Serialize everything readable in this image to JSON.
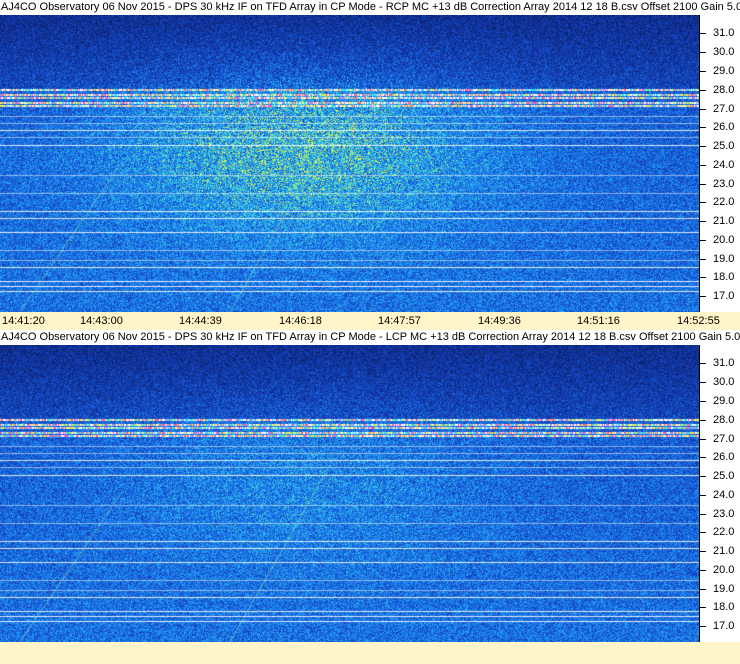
{
  "panels": [
    {
      "title": "AJ4CO Observatory 06 Nov 2015 - DPS 30 kHz IF on TFD Array in CP Mode - RCP  MC +13 dB  Correction Array 2014 12 18 B.csv  Offset 2100  Gain 5.0",
      "freq_labels": [
        "31.0",
        "30.0",
        "29.0",
        "28.0",
        "27.0",
        "26.0",
        "25.0",
        "24.0",
        "23.0",
        "22.0",
        "21.0",
        "20.0",
        "19.0",
        "18.0",
        "17.0"
      ],
      "time_labels": [
        "14:41:20",
        "14:43:00",
        "14:44:39",
        "14:46:18",
        "14:47:57",
        "14:49:36",
        "14:51:16",
        "14:52:55"
      ]
    },
    {
      "title": "AJ4CO Observatory 06 Nov 2015 - DPS 30 kHz IF on TFD Array in CP Mode - LCP  MC +13 dB  Correction Array 2014 12 18 B.csv  Offset 2100  Gain 5.0",
      "freq_labels": [
        "31.0",
        "30.0",
        "29.0",
        "28.0",
        "27.0",
        "26.0",
        "25.0",
        "24.0",
        "23.0",
        "22.0",
        "21.0",
        "20.0",
        "19.0",
        "18.0",
        "17.0"
      ],
      "time_labels": []
    }
  ],
  "colors": {
    "spectrogram_deep": "#0a1a5c",
    "spectrogram_mid": "#1f63c8",
    "spectrogram_bright": "#3aa3ff",
    "band_hot": "#ff60c0",
    "axis_background": "#fff5c8"
  }
}
